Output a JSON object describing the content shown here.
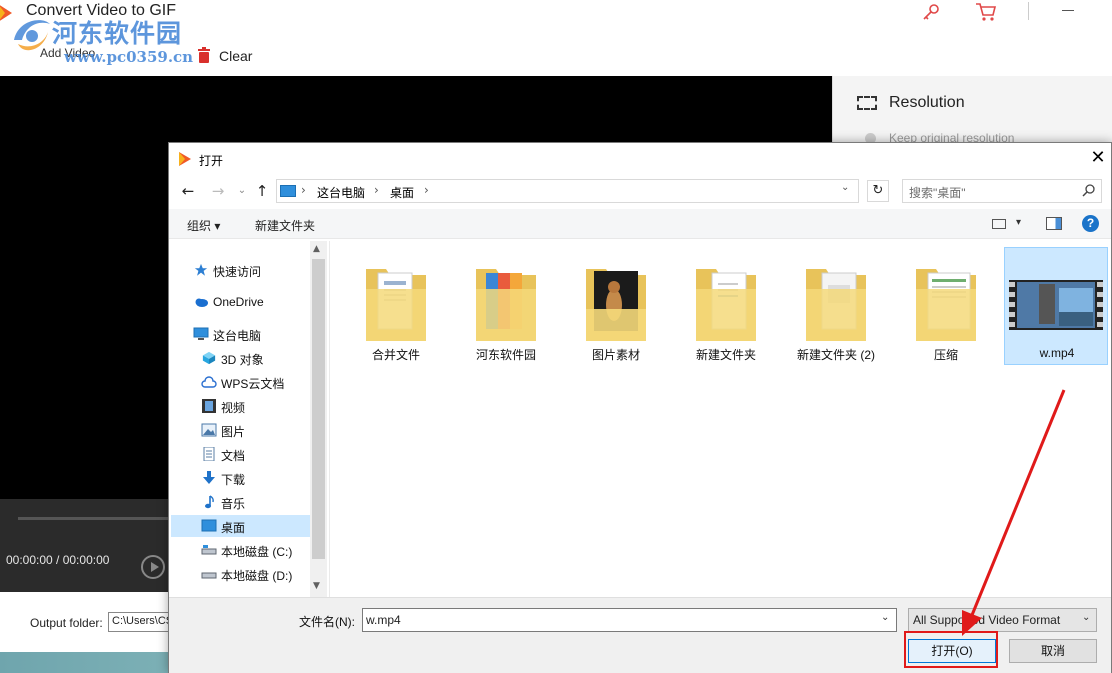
{
  "app": {
    "title": "Convert Video to GIF",
    "toolbar": {
      "add_video_label": "Add Video",
      "clear_label": "Clear"
    },
    "player": {
      "time": "00:00:00  /  00:00:00"
    },
    "output": {
      "label": "Output folder:",
      "value": "C:\\Users\\CS"
    },
    "right_panel": {
      "resolution_title": "Resolution",
      "keep_original": "Keep original resolution"
    }
  },
  "watermark": {
    "text": "河东软件园",
    "url": "www.pc0359.cn"
  },
  "dialog": {
    "title": "打开",
    "breadcrumb": [
      "这台电脑",
      "桌面"
    ],
    "search_placeholder": "搜索\"桌面\"",
    "commands": {
      "organize": "组织 ▾",
      "new_folder": "新建文件夹"
    },
    "nav_items": [
      {
        "label": "快速访问",
        "icon": "star-icon"
      },
      {
        "label": "OneDrive",
        "icon": "cloud-icon"
      },
      {
        "label": "这台电脑",
        "icon": "computer-icon"
      },
      {
        "label": "3D 对象",
        "icon": "cube-icon"
      },
      {
        "label": "WPS云文档",
        "icon": "cloud-doc-icon"
      },
      {
        "label": "视频",
        "icon": "video-folder-icon"
      },
      {
        "label": "图片",
        "icon": "picture-folder-icon"
      },
      {
        "label": "文档",
        "icon": "document-folder-icon"
      },
      {
        "label": "下载",
        "icon": "download-icon"
      },
      {
        "label": "音乐",
        "icon": "music-icon"
      },
      {
        "label": "桌面",
        "icon": "desktop-icon",
        "selected": true
      },
      {
        "label": "本地磁盘 (C:)",
        "icon": "drive-icon"
      },
      {
        "label": "本地磁盘 (D:)",
        "icon": "drive-icon"
      }
    ],
    "files": [
      {
        "name": "合并文件",
        "type": "folder"
      },
      {
        "name": "河东软件园",
        "type": "folder"
      },
      {
        "name": "图片素材",
        "type": "folder"
      },
      {
        "name": "新建文件夹",
        "type": "folder"
      },
      {
        "name": "新建文件夹 (2)",
        "type": "folder"
      },
      {
        "name": "压缩",
        "type": "folder"
      },
      {
        "name": "w.mp4",
        "type": "video",
        "selected": true
      }
    ],
    "filename_label": "文件名(N):",
    "filename_value": "w.mp4",
    "filetype_value": "All Supported Video Format",
    "open_button": "打开(O)",
    "cancel_button": "取消"
  },
  "colors": {
    "annotation_red": "#e01a1a",
    "selection_blue": "#cce8ff",
    "accent_blue": "#0078d7"
  }
}
